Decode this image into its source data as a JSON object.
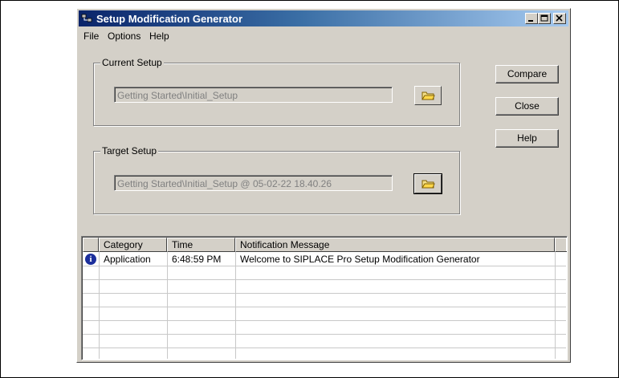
{
  "window": {
    "title": "Setup Modification Generator"
  },
  "menu": {
    "file": "File",
    "options": "Options",
    "help": "Help"
  },
  "current_setup": {
    "label": "Current Setup",
    "value": "Getting Started\\Initial_Setup"
  },
  "target_setup": {
    "label": "Target Setup",
    "value": "Getting Started\\Initial_Setup @ 05-02-22 18.40.26"
  },
  "buttons": {
    "compare": "Compare",
    "close": "Close",
    "help": "Help"
  },
  "log": {
    "columns": [
      "Category",
      "Time",
      "Notification Message"
    ],
    "rows": [
      {
        "icon": "info-icon",
        "icon_glyph": "i",
        "category": "Application",
        "time": "6:48:59 PM",
        "message": "Welcome to SIPLACE Pro Setup Modification Generator"
      }
    ]
  },
  "colors": {
    "title_bar_start": "#0a246a",
    "title_bar_end": "#a6caf0",
    "face": "#d4d0c8",
    "info_icon": "#1c2f9c"
  }
}
